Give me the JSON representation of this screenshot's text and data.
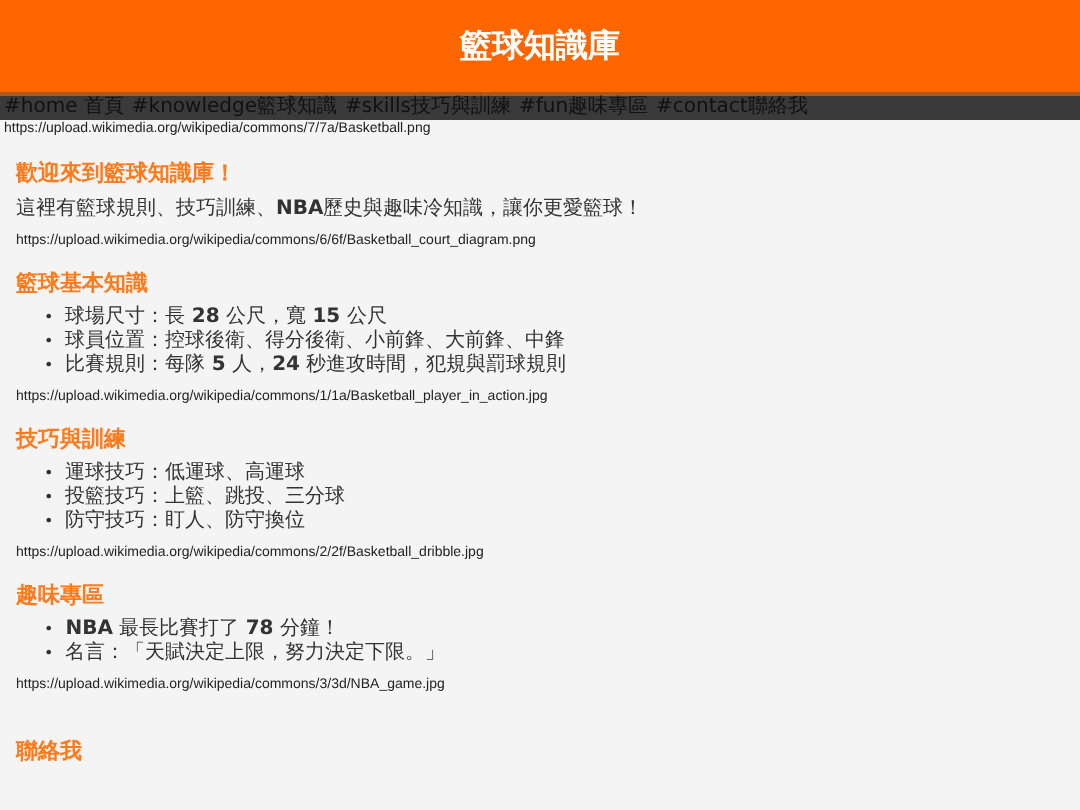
{
  "header": {
    "title": "籃球知識庫"
  },
  "nav": {
    "links": [
      "#home 首頁",
      "#knowledge籃球知識",
      "#skills技巧與訓練",
      "#fun趣味專區",
      "#contact聯絡我"
    ]
  },
  "hero_image": {
    "alt": "https://upload.wikimedia.org/wikipedia/commons/7/7a/Basketball.png"
  },
  "sections": [
    {
      "heading": "歡迎來到籃球知識庫！",
      "paragraph": "這裡有籃球規則、技巧訓練、**NBA**歷史與趣味冷知識，讓你更愛籃球！",
      "image_alt": "https://upload.wikimedia.org/wikipedia/commons/6/6f/Basketball_court_diagram.png"
    },
    {
      "heading": "籃球基本知識",
      "items": [
        {
          "bullet": "•",
          "text": "球場尺寸：長 **28** 公尺，寬 **15** 公尺"
        },
        {
          "bullet": "•",
          "text": "球員位置：控球後衛、得分後衛、小前鋒、大前鋒、中鋒"
        },
        {
          "bullet": "•",
          "text": "比賽規則：每隊 **5** 人，**24** 秒進攻時間，犯規與罰球規則"
        }
      ],
      "image_alt": "https://upload.wikimedia.org/wikipedia/commons/1/1a/Basketball_player_in_action.jpg"
    },
    {
      "heading": "技巧與訓練",
      "items": [
        {
          "bullet": "•",
          "text": "運球技巧：低運球、高運球"
        },
        {
          "bullet": "•",
          "text": "投籃技巧：上籃、跳投、三分球"
        },
        {
          "bullet": "•",
          "text": "防守技巧：盯人、防守換位"
        }
      ],
      "image_alt": "https://upload.wikimedia.org/wikipedia/commons/2/2f/Basketball_dribble.jpg"
    },
    {
      "heading": "趣味專區",
      "items": [
        {
          "bullet": "•",
          "text": "**NBA** 最長比賽打了 **78** 分鐘！"
        },
        {
          "bullet": "•",
          "text": "名言：「天賦決定上限，努力決定下限。」"
        }
      ],
      "image_alt": "https://upload.wikimedia.org/wikipedia/commons/3/3d/NBA_game.jpg"
    },
    {
      "heading": "聯絡我"
    }
  ]
}
